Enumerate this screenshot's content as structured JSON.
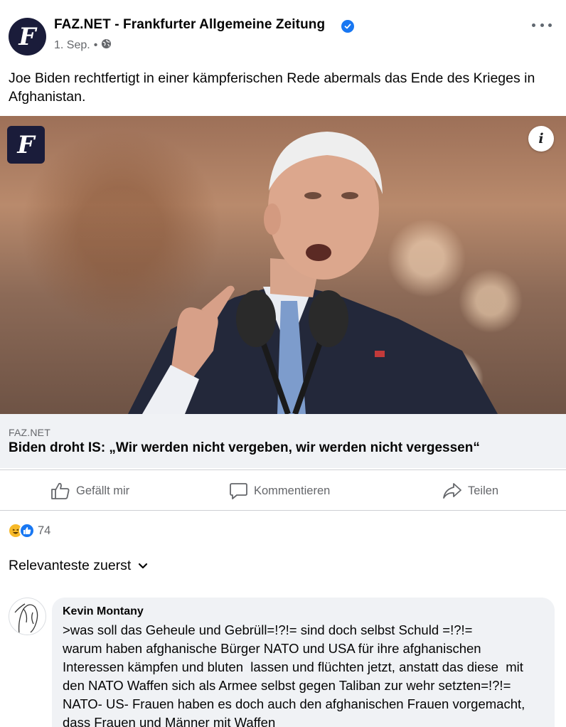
{
  "post": {
    "page_name": "FAZ.NET - Frankfurter Allgemeine Zeitung",
    "avatar_letter": "F",
    "date": "1. Sep.",
    "separator": "•",
    "audience_icon": "globe-icon",
    "text": "Joe Biden rechtfertigt in einer kämpferischen Rede abermals das Ende des Krieges in Afghanistan."
  },
  "photo": {
    "logo_letter": "F",
    "info_label": "i"
  },
  "link": {
    "domain": "FAZ.NET",
    "title": "Biden droht IS: „Wir werden nicht vergeben, wir werden nicht vergessen“"
  },
  "actions": {
    "like": "Gefällt mir",
    "comment": "Kommentieren",
    "share": "Teilen"
  },
  "reactions": {
    "icons": [
      "haha-icon",
      "like-icon"
    ],
    "count": "74"
  },
  "comments": {
    "sort_label": "Relevanteste zuerst",
    "items": [
      {
        "author": "Kevin Montany",
        "text": ">was soll das Geheule und Gebrüll=!?!= sind doch selbst Schuld =!?!=\nwarum haben afghanische Bürger NATO und USA für ihre afghanischen Interessen kämpfen und bluten  lassen und flüchten jetzt, anstatt das diese  mit den NATO Waffen sich als Armee selbst gegen Taliban zur wehr setzten=!?!= NATO- US- Frauen haben es doch auch den afghanischen Frauen vorgemacht, dass Frauen und Männer mit Waffen"
      }
    ]
  },
  "colors": {
    "brand_blue": "#1877f2",
    "secondary_text": "#65676b",
    "card_background": "#f0f2f5",
    "faz_navy": "#1a1c3a"
  }
}
